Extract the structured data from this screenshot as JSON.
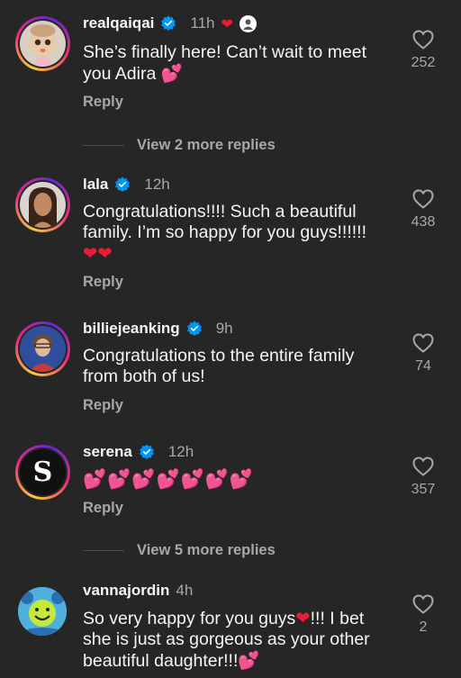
{
  "comments": [
    {
      "username": "realqaiqai",
      "time": "11h",
      "text": "She’s finally here! Can’t wait to meet you Adira",
      "emoji": "💕",
      "reply": "Reply",
      "likes": "252",
      "liked_by_creator": true
    },
    {
      "username": "lala",
      "time": "12h",
      "text": "Congratulations!!!! Such a beautiful family. I’m so happy for you guys!!!!!!",
      "emoji": "❤❤",
      "reply": "Reply",
      "likes": "438"
    },
    {
      "username": "billiejeanking",
      "time": "9h",
      "text": "Congratulations to the entire family from both of us!",
      "reply": "Reply",
      "likes": "74"
    },
    {
      "username": "serena",
      "time": "12h",
      "emoji": "💕💕💕💕💕💕💕",
      "reply": "Reply",
      "likes": "357",
      "avatar_letter": "S"
    },
    {
      "username": "vannajordin",
      "time": "4h",
      "text_part1": "So very happy for you guys",
      "text_heart": "❤",
      "text_part2": "!!! I bet she is just as gorgeous as your other beautiful daughter!!!",
      "emoji": "💕",
      "likes": "2"
    }
  ],
  "view_more_1": "View 2 more replies",
  "view_more_2": "View 5 more replies",
  "colors": {
    "background": "#262626",
    "text": "#f5f5f5",
    "secondary": "#a8a8a8",
    "verified": "#0095f6",
    "heart_red": "#ed1c35"
  }
}
